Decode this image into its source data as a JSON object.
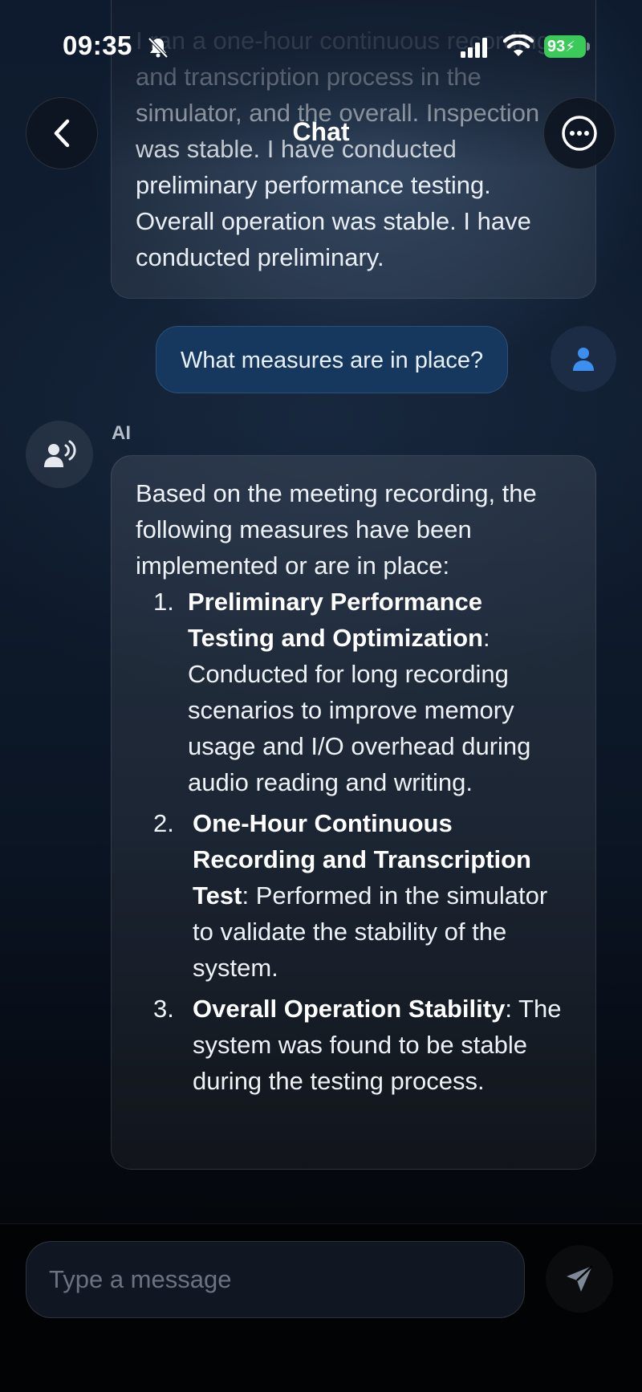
{
  "status_bar": {
    "time": "09:35",
    "battery": "93"
  },
  "header": {
    "title": "Chat",
    "back_icon": "chevron-left-icon",
    "more_icon": "ellipsis-icon"
  },
  "messages": {
    "previous_ai_tail": "I ran a one-hour continuous recording and transcription process in the simulator, and the overall. Inspection was stable. I have conducted preliminary performance testing. Overall operation was stable. I have conducted preliminary.",
    "user": {
      "text": "What measures are in place?",
      "avatar_icon": "person-icon"
    },
    "ai": {
      "label": "AI",
      "avatar_icon": "voice-assistant-icon",
      "intro": "Based on the meeting recording, the following measures have been implemented or are in place:",
      "items": [
        {
          "number": "1.",
          "title": "Preliminary Performance Testing and Optimization",
          "text": "Conducted for long recording scenarios to improve memory usage and I/O overhead during audio reading and writing."
        },
        {
          "number": "2.",
          "title": "One-Hour Continuous Recording and Transcription Test",
          "text": "Performed in the simulator to validate the stability of the system."
        },
        {
          "number": "3.",
          "title": "Overall Operation Stability",
          "text": "The system was found to be stable during the testing process."
        }
      ]
    }
  },
  "composer": {
    "placeholder": "Type a message",
    "value": "",
    "send_icon": "send-icon"
  },
  "colors": {
    "user_bubble": "#16385f",
    "accent_blue": "#3b8ff0",
    "battery_green": "#3bc95a"
  }
}
